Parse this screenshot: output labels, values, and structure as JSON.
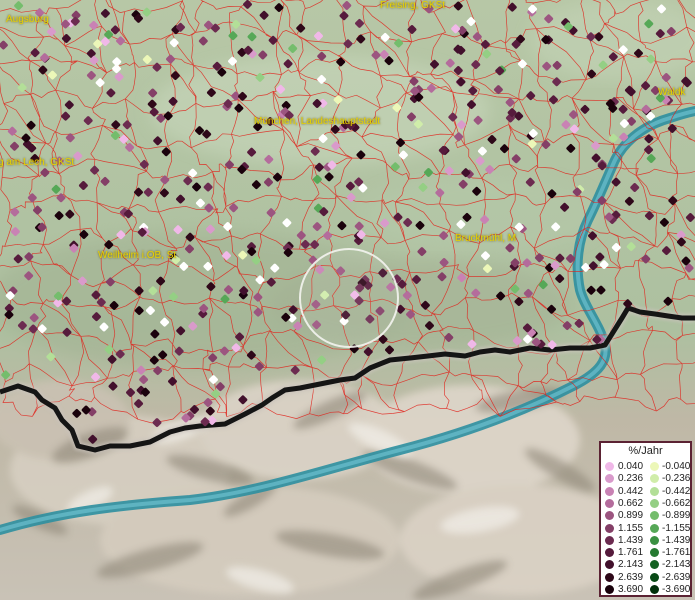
{
  "place_labels": {
    "augsburg": "Augsburg",
    "freising": "Freising, GKSt",
    "walde": "Waldk",
    "muenchen": "München, Landeshauptstadt",
    "lech": "g am Lech, GKSt",
    "weilheim": "Weilheim i.OB, St",
    "bruckmuehl": "Bruckmühl, M"
  },
  "legend": {
    "title": "%/Jahr",
    "positive": [
      "0.040",
      "0.236",
      "0.442",
      "0.662",
      "0.899",
      "1.155",
      "1.439",
      "1.761",
      "2.143",
      "2.639",
      "3.690"
    ],
    "negative": [
      "-0.040",
      "-0.236",
      "-0.442",
      "-0.662",
      "-0.899",
      "-1.155",
      "-1.439",
      "-1.761",
      "-2.143",
      "-2.639",
      "-3.690"
    ],
    "positive_colors": [
      "#f0b8e8",
      "#d99acb",
      "#c982b4",
      "#b46c9c",
      "#9c5580",
      "#843f67",
      "#6c2b50",
      "#561b3c",
      "#42102c",
      "#2e0819",
      "#1a020c"
    ],
    "negative_colors": [
      "#ecf7b8",
      "#d0edaa",
      "#b3df98",
      "#94cf84",
      "#74bd6c",
      "#56a857",
      "#3b9142",
      "#267a31",
      "#146222",
      "#084a16",
      "#01300b"
    ]
  }
}
